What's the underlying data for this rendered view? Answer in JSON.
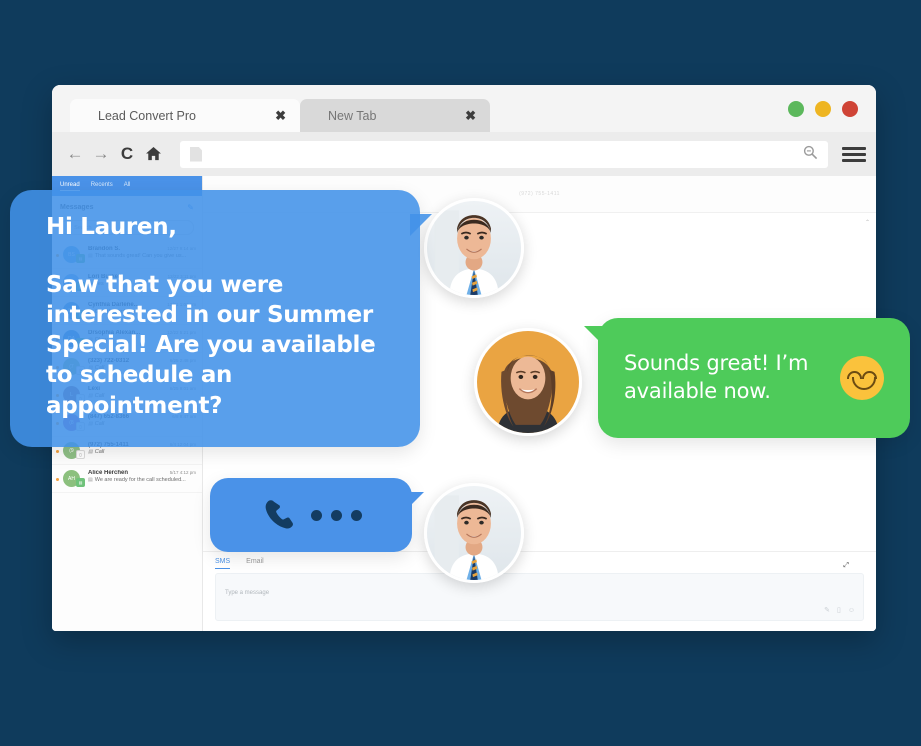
{
  "page": {
    "background_color": "#0f3b5c"
  },
  "browser": {
    "tabs": [
      {
        "label": "Lead Convert Pro",
        "active": true,
        "close_glyph": "✖"
      },
      {
        "label": "New Tab",
        "active": false,
        "close_glyph": "✖"
      }
    ],
    "window_dots": [
      {
        "name": "minimize",
        "color": "#5cb85c"
      },
      {
        "name": "maximize",
        "color": "#eeb522"
      },
      {
        "name": "close",
        "color": "#cf4436"
      }
    ],
    "toolbar": {
      "back_glyph": "←",
      "forward_glyph": "→",
      "reload_glyph": "C",
      "home_glyph": "⌂",
      "url_value": "",
      "url_placeholder": "",
      "search_glyph": "⌕",
      "menu_label": "menu"
    }
  },
  "sidebar": {
    "tabs": [
      {
        "label": "Unread",
        "active": true
      },
      {
        "label": "Recents",
        "active": false
      },
      {
        "label": "All",
        "active": false
      }
    ],
    "title": "Messages",
    "compose_glyph": "✎",
    "search_placeholder": "Search",
    "search_glyph": "⌕",
    "contacts": [
      {
        "name": "Brandon S.",
        "initials": "BS",
        "color": "#6fb3e0",
        "time": "12/27 9:14 am",
        "preview": "That sounds great! Can you give us...",
        "channel": "sms",
        "unread": true,
        "italic": false
      },
      {
        "name": "Lori Burkell",
        "initials": "LB",
        "color": "#7bb6e8",
        "time": "12/22 3:11 pm",
        "preview": "Yes",
        "channel": "sms",
        "unread": true,
        "italic": false
      },
      {
        "name": "Cynthia Darlene...",
        "initials": "CD",
        "color": "#5e9fd4",
        "time": "12/21 1:03 pm",
        "preview": "Great! Thank you",
        "channel": "sms",
        "unread": true,
        "italic": false
      },
      {
        "name": "Drsophia Alexan...",
        "initials": "DA",
        "color": "#4d8fc9",
        "time": "12/22 5:21 pm",
        "preview": "Okay",
        "channel": "sms",
        "unread": true,
        "italic": false
      },
      {
        "name": "(323) 722-0312",
        "initials": "(7",
        "color": "#9ec58a",
        "time": "6/25 2:48 pm",
        "preview": "Call",
        "channel": "phone",
        "unread": true,
        "italic": true
      },
      {
        "name": "Lexi",
        "initials": "L",
        "color": "#9b6f86",
        "time": "6/25 9:01 am",
        "preview": "Call",
        "channel": "phone",
        "unread": true,
        "italic": true
      },
      {
        "name": "(847) 652-8366",
        "initials": "(8",
        "color": "#a86fc4",
        "time": "6/8 9:47 am",
        "preview": "Call",
        "channel": "phone",
        "unread": true,
        "italic": true
      },
      {
        "name": "(972) 755-1411",
        "initials": "(9",
        "color": "#8fbf86",
        "time": "6/4 12:04 pm",
        "preview": "Call",
        "channel": "phone",
        "unread": true,
        "italic": true
      },
      {
        "name": "Alice Herchen",
        "initials": "AH",
        "color": "#8cc07e",
        "time": "5/17 4:12 pm",
        "preview": "We are ready for the call scheduled...",
        "channel": "sms",
        "unread": true,
        "italic": false
      }
    ]
  },
  "conversation": {
    "header_title": "(972) 755-1411",
    "scroll_top_glyph": "⌃",
    "expand_glyph": "⤢",
    "composer": {
      "tabs": [
        {
          "label": "SMS",
          "active": true
        },
        {
          "label": "Email",
          "active": false
        }
      ],
      "placeholder": "Type a message",
      "actions": [
        {
          "name": "attachment-icon",
          "glyph": "✎"
        },
        {
          "name": "template-icon",
          "glyph": "▯"
        },
        {
          "name": "emoji-icon",
          "glyph": "☺"
        }
      ]
    }
  },
  "overlays": {
    "blue_bubble": {
      "greeting": "Hi Lauren,",
      "body": "Saw that you were interested in our Summer Special! Are you available to schedule an appointment?",
      "color": "#4292e8"
    },
    "green_bubble": {
      "text": "Sounds great! I’m available now.",
      "color": "#4ecb5a",
      "emoji_name": "smiling-face-emoji"
    },
    "call_bubble": {
      "phone_icon_name": "phone-handset-icon",
      "typing_dots": 3,
      "color": "#4a92e8"
    },
    "avatars": [
      {
        "name": "agent-avatar-top",
        "alt": "Man in white coat and blue shirt"
      },
      {
        "name": "customer-avatar",
        "alt": "Smiling woman with brown hair on orange background"
      },
      {
        "name": "agent-avatar-bottom",
        "alt": "Man in white coat and blue shirt"
      }
    ]
  }
}
